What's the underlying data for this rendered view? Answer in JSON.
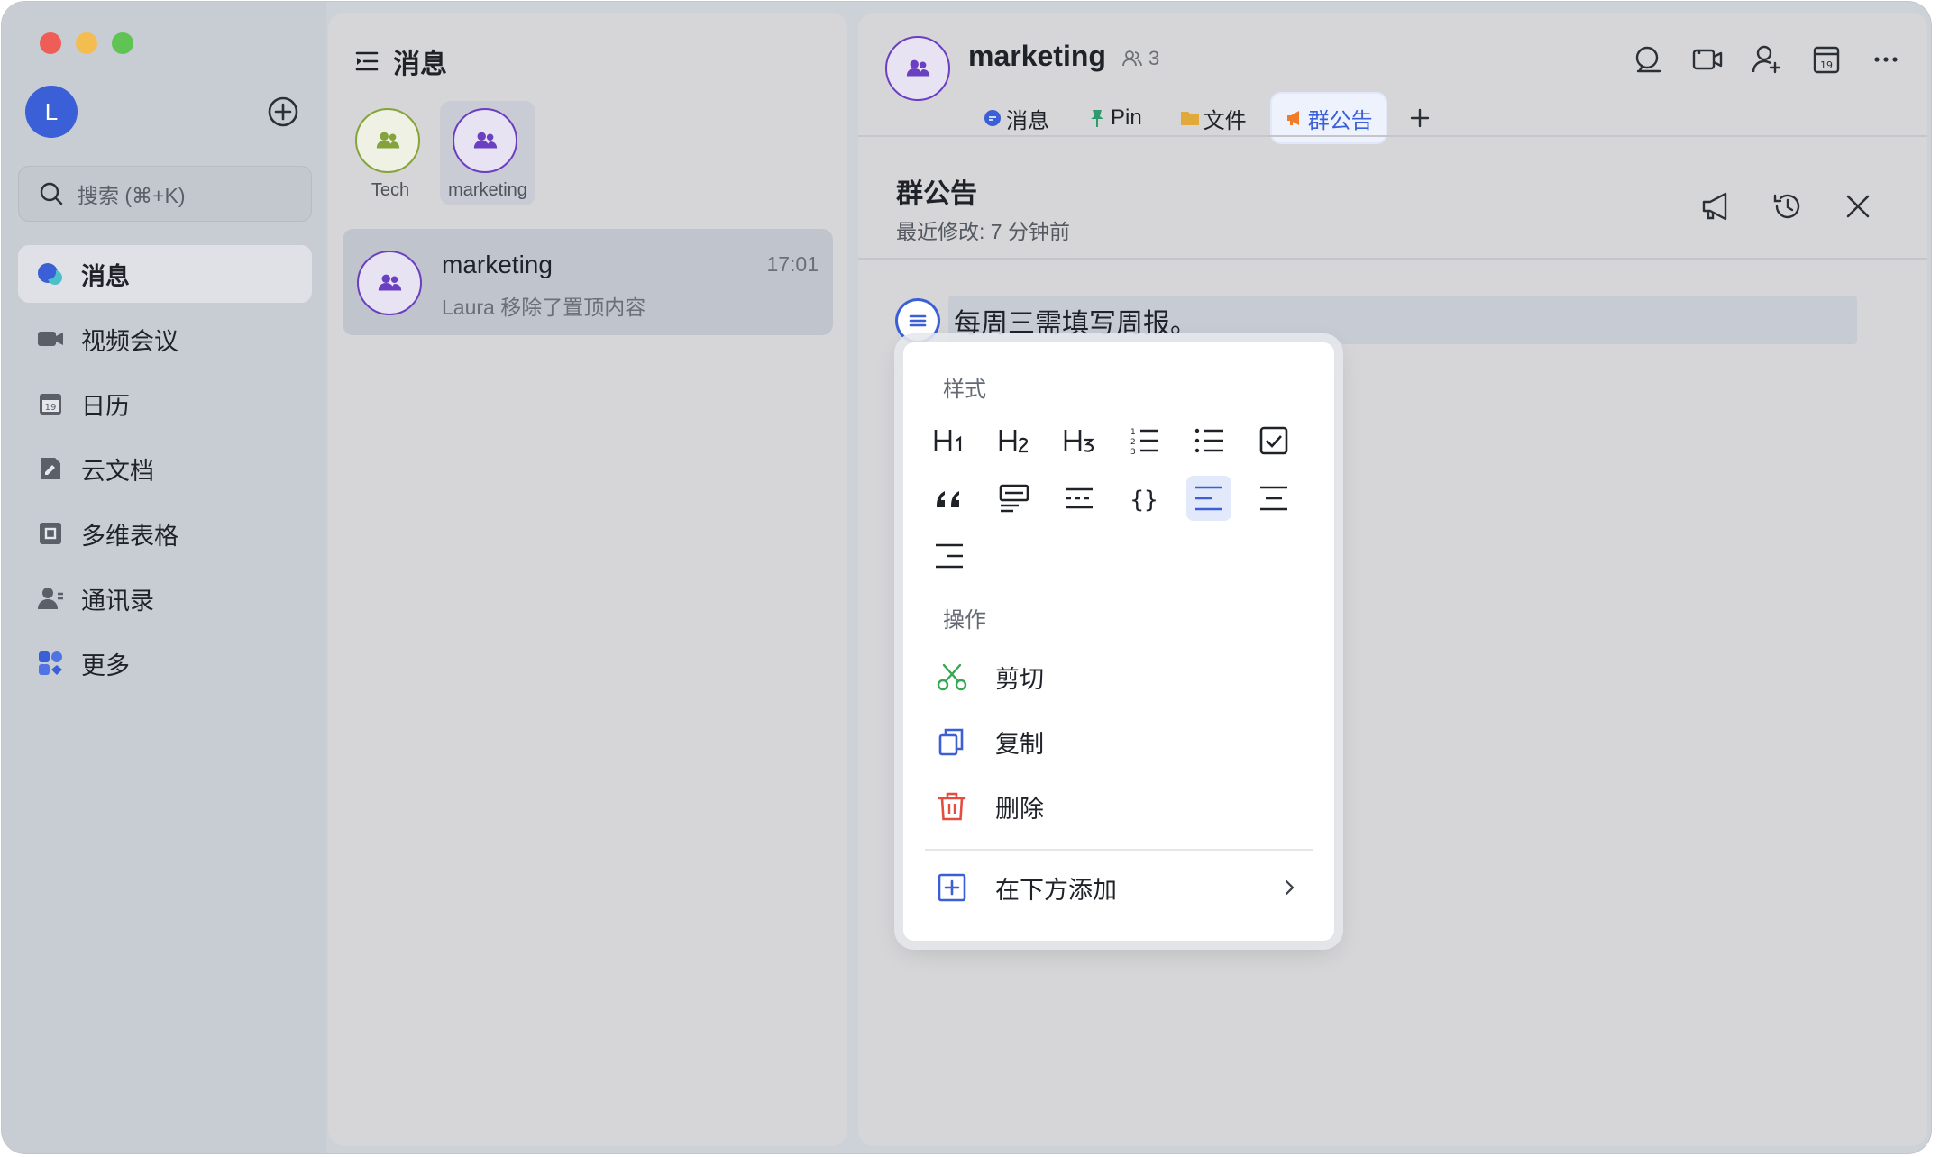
{
  "window": {
    "traffic_lights": {
      "close": "#ee5d56",
      "minimize": "#f4bd4f",
      "maximize": "#5fc454"
    }
  },
  "colors": {
    "accent": "#3a5fd6",
    "group_purple": "#6a3fc2",
    "tech_olive": "#85a33b",
    "cut_green": "#35a853",
    "delete_red": "#e54d3f",
    "announcement_orange": "#f07b28"
  },
  "sidebar": {
    "avatar_initial": "L",
    "search_placeholder": "搜索 (⌘+K)",
    "items": [
      {
        "label": "消息",
        "icon": "chat-bubble-icon",
        "active": true
      },
      {
        "label": "视频会议",
        "icon": "video-camera-icon",
        "active": false
      },
      {
        "label": "日历",
        "icon": "calendar-icon",
        "active": false
      },
      {
        "label": "云文档",
        "icon": "cloud-doc-icon",
        "active": false
      },
      {
        "label": "多维表格",
        "icon": "base-table-icon",
        "active": false
      },
      {
        "label": "通讯录",
        "icon": "contacts-icon",
        "active": false
      },
      {
        "label": "更多",
        "icon": "more-apps-icon",
        "active": false
      }
    ]
  },
  "chat_list": {
    "title": "消息",
    "pinned": [
      {
        "label": "Tech",
        "selected": false
      },
      {
        "label": "marketing",
        "selected": true
      }
    ],
    "conversations": [
      {
        "name": "marketing",
        "time": "17:01",
        "preview": "Laura 移除了置顶内容"
      }
    ]
  },
  "chat": {
    "group_name": "marketing",
    "member_count": "3",
    "tabs": [
      {
        "label": "消息",
        "icon": "chat-dot-icon",
        "active": false
      },
      {
        "label": "Pin",
        "icon": "pin-icon",
        "active": false
      },
      {
        "label": "文件",
        "icon": "folder-icon",
        "active": false
      },
      {
        "label": "群公告",
        "icon": "megaphone-icon",
        "active": true
      }
    ],
    "top_icons": [
      "search-icon",
      "video-camera-icon",
      "add-member-icon",
      "calendar-icon",
      "more-icon"
    ]
  },
  "announcement": {
    "title": "群公告",
    "subtitle": "最近修改: 7 分钟前",
    "block_text": "每周三需填写周报。"
  },
  "popup": {
    "style_label": "样式",
    "actions_label": "操作",
    "styles": [
      "h1",
      "h2",
      "h3",
      "ordered-list",
      "bullet-list",
      "checkbox",
      "quote",
      "callout",
      "divider",
      "code-block",
      "align-left",
      "align-center",
      "align-right"
    ],
    "active_style": "align-left",
    "actions": [
      {
        "label": "剪切",
        "icon": "scissors-icon"
      },
      {
        "label": "复制",
        "icon": "copy-icon"
      },
      {
        "label": "删除",
        "icon": "trash-icon"
      }
    ],
    "add_below": "在下方添加"
  }
}
